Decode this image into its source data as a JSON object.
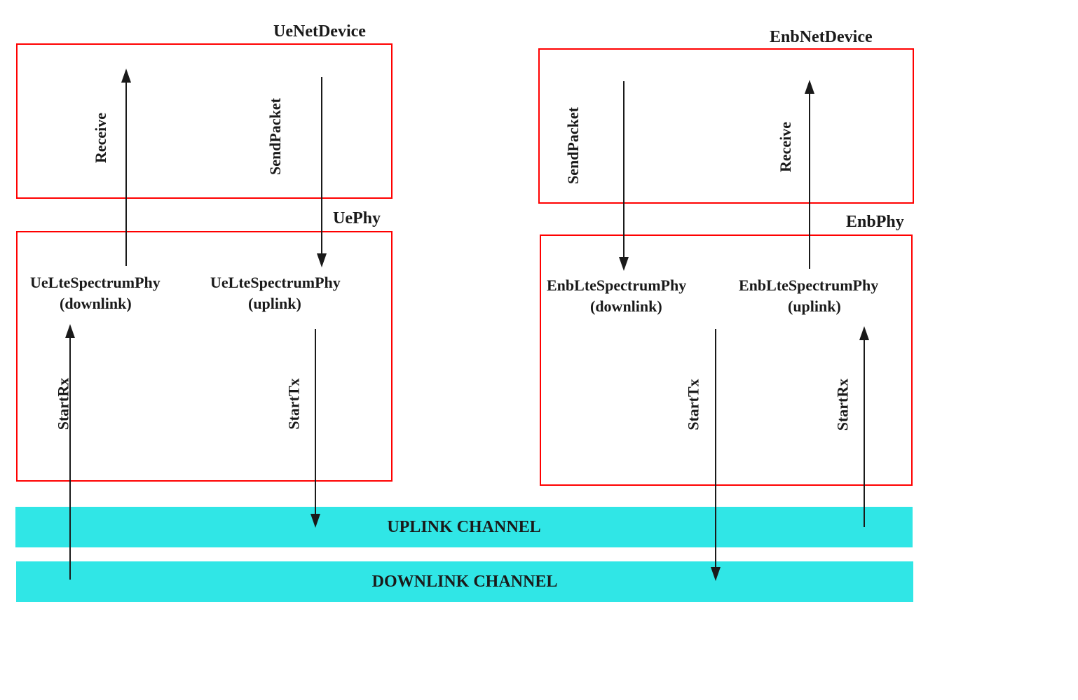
{
  "diagram": {
    "ue": {
      "title": "UeNetDevice",
      "phy_title": "UePhy",
      "downlink_label1": "UeLteSpectrumPhy",
      "downlink_label2": "(downlink)",
      "uplink_label1": "UeLteSpectrumPhy",
      "uplink_label2": "(uplink)"
    },
    "enb": {
      "title": "EnbNetDevice",
      "phy_title": "EnbPhy",
      "downlink_label1": "EnbLteSpectrumPhy",
      "downlink_label2": "(downlink)",
      "uplink_label1": "EnbLteSpectrumPhy",
      "uplink_label2": "(uplink)"
    },
    "arrows": {
      "receive": "Receive",
      "sendpacket": "SendPacket",
      "startrx": "StartRx",
      "starttx": "StartTx"
    },
    "channels": {
      "uplink": "UPLINK CHANNEL",
      "downlink": "DOWNLINK CHANNEL"
    }
  }
}
